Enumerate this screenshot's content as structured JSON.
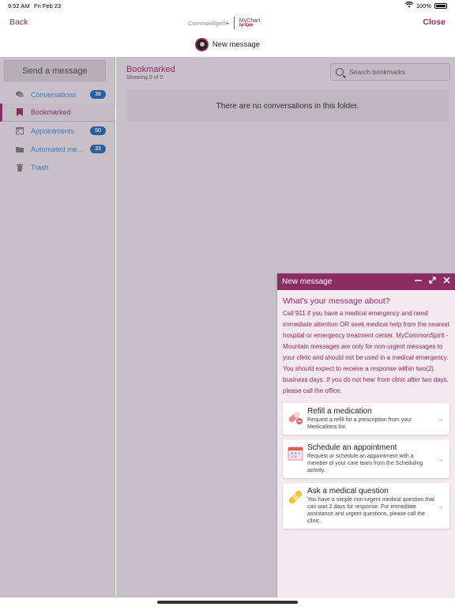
{
  "status": {
    "time": "9:52 AM",
    "date": "Fri Feb 23",
    "battery": "100%"
  },
  "header": {
    "back_label": "Back",
    "close_label": "Close",
    "brand": "CommonSpirit",
    "brand2": "MyChart",
    "brand2_sub": "by Epic",
    "page_title": "New message"
  },
  "sidebar": {
    "send_label": "Send a message",
    "items": [
      {
        "label": "Conversations",
        "badge": "38",
        "icon": "chat-bubbles-icon"
      },
      {
        "label": "Bookmarked",
        "badge": "",
        "icon": "bookmark-icon"
      },
      {
        "label": "Appointments",
        "badge": "50",
        "icon": "calendar-icon"
      },
      {
        "label": "Automated me...",
        "badge": "33",
        "icon": "folder-icon"
      },
      {
        "label": "Trash",
        "badge": "",
        "icon": "trash-icon"
      }
    ],
    "active_index": 1
  },
  "main": {
    "folder_title": "Bookmarked",
    "showing": "Showing 0 of 0",
    "search_placeholder": "Search bookmarks",
    "empty_text": "There are no conversations in this folder."
  },
  "popup": {
    "title": "New message",
    "question": "What's your message about?",
    "notice": "Call 911 if you have a medical emergency and need immediate attention OR seek medical help from the nearest hospital or emergency treatment center. MyCommonSpirit - Mountain messages are only for non-urgent messages to your clinic and should not be used in a medical emergency. You should expect to receive a response within two(2) business days. If you do not hear from clinic after two days, please call the office.",
    "options": [
      {
        "title": "Refill a medication",
        "desc": "Request a refill for a prescription from your Medications list."
      },
      {
        "title": "Schedule an appointment",
        "desc": "Request or schedule an appointment with a member of your care team from the Scheduling activity."
      },
      {
        "title": "Ask a medical question",
        "desc": "You have a simple non-urgent medical question that can wait 2 days for response. For immediate assistance and urgent questions, please call the clinic."
      }
    ]
  },
  "colors": {
    "accent": "#8b2d63",
    "link": "#3f78b8",
    "badge": "#2d5d9a"
  }
}
